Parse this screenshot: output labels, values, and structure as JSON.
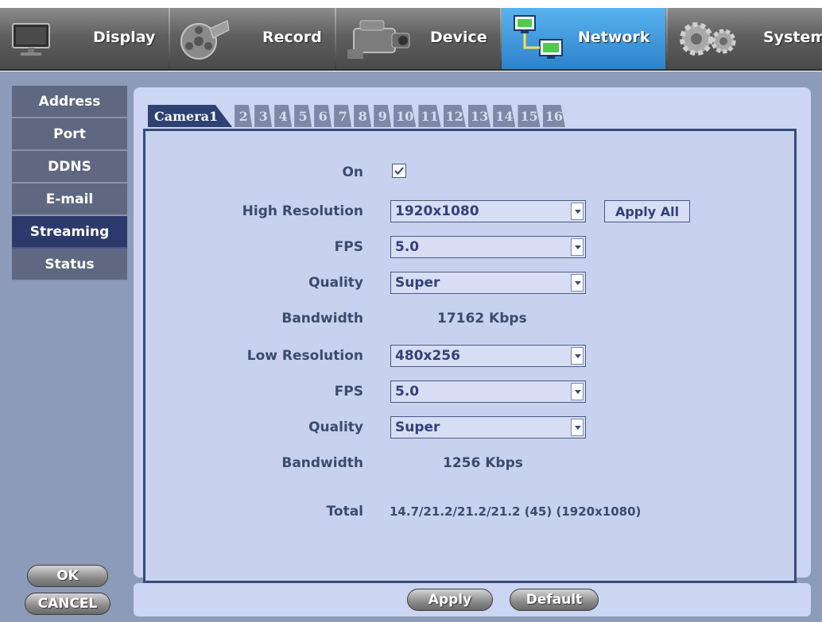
{
  "top_menu": [
    {
      "label": "Display",
      "icon": "monitor-icon",
      "active": false
    },
    {
      "label": "Record",
      "icon": "film-reel-icon",
      "active": false
    },
    {
      "label": "Device",
      "icon": "camcorder-icon",
      "active": false
    },
    {
      "label": "Network",
      "icon": "network-icon",
      "active": true
    },
    {
      "label": "System",
      "icon": "gears-icon",
      "active": false
    }
  ],
  "sidebar": [
    {
      "label": "Address",
      "active": false
    },
    {
      "label": "Port",
      "active": false
    },
    {
      "label": "DDNS",
      "active": false
    },
    {
      "label": "E-mail",
      "active": false
    },
    {
      "label": "Streaming",
      "active": true
    },
    {
      "label": "Status",
      "active": false
    }
  ],
  "tabs": [
    "Camera1",
    "2",
    "3",
    "4",
    "5",
    "6",
    "7",
    "8",
    "9",
    "10",
    "11",
    "12",
    "13",
    "14",
    "15",
    "16"
  ],
  "form": {
    "on_label": "On",
    "on_checked": true,
    "high_res_label": "High Resolution",
    "high_res_value": "1920x1080",
    "apply_all_label": "Apply All",
    "fps_label": "FPS",
    "high_fps_value": "5.0",
    "quality_label": "Quality",
    "high_quality_value": "Super",
    "bandwidth_label": "Bandwidth",
    "high_bandwidth_value": "17162 Kbps",
    "low_res_label": "Low Resolution",
    "low_res_value": "480x256",
    "low_fps_value": "5.0",
    "low_quality_value": "Super",
    "low_bandwidth_value": "1256 Kbps",
    "total_label": "Total",
    "total_value": "14.7/21.2/21.2/21.2 (45) (1920x1080)"
  },
  "buttons": {
    "ok": "OK",
    "cancel": "CANCEL",
    "apply": "Apply",
    "default": "Default"
  },
  "colors": {
    "active_menu": "#3a92d6",
    "sidebar_active": "#2b3a6b",
    "panel_bg": "#ccd5f1"
  }
}
